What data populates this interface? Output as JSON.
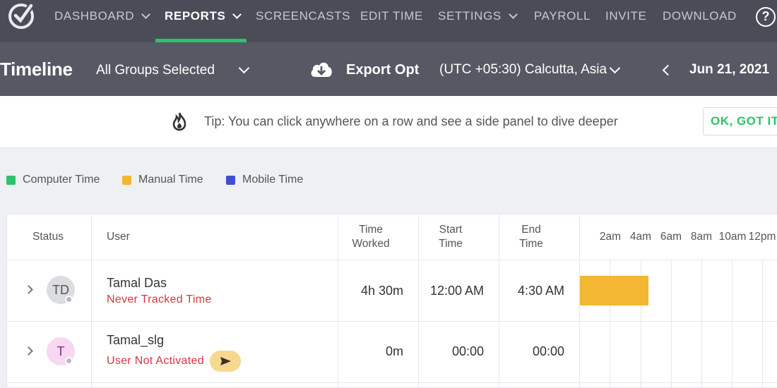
{
  "nav": {
    "items": [
      {
        "label": "DASHBOARD",
        "has_dropdown": true,
        "active": false
      },
      {
        "label": "REPORTS",
        "has_dropdown": true,
        "active": true
      },
      {
        "label": "SCREENCASTS",
        "has_dropdown": false,
        "active": false
      },
      {
        "label": "EDIT TIME",
        "has_dropdown": false,
        "active": false
      },
      {
        "label": "SETTINGS",
        "has_dropdown": true,
        "active": false
      },
      {
        "label": "PAYROLL",
        "has_dropdown": false,
        "active": false
      },
      {
        "label": "INVITE",
        "has_dropdown": false,
        "active": false
      },
      {
        "label": "DOWNLOAD",
        "has_dropdown": false,
        "active": false
      }
    ],
    "help_label": "?"
  },
  "subheader": {
    "title": "Timeline",
    "groups": "All Groups Selected",
    "export": "Export Opt",
    "timezone": "(UTC +05:30) Calcutta, Asia",
    "date": "Jun 21, 2021"
  },
  "tip": {
    "text": "Tip: You can click anywhere on a row and see a side panel to dive deeper",
    "button": "OK, GOT IT"
  },
  "legend": [
    {
      "label": "Computer Time",
      "color": "#2ec26a"
    },
    {
      "label": "Manual Time",
      "color": "#f4b733"
    },
    {
      "label": "Mobile Time",
      "color": "#3f4fd1"
    }
  ],
  "table": {
    "headers": {
      "status": "Status",
      "user": "User",
      "time_worked_1": "Time",
      "time_worked_2": "Worked",
      "start_1": "Start",
      "start_2": "Time",
      "end_1": "End",
      "end_2": "Time"
    },
    "timeline_ticks": [
      "2am",
      "4am",
      "6am",
      "8am",
      "10am",
      "12pm"
    ],
    "rows": [
      {
        "avatar": "TD",
        "avatar_bg": "#dcdde1",
        "avatar_color": "#555555",
        "name": "Tamal Das",
        "status": "Never Tracked Time",
        "time_worked": "4h 30m",
        "start": "12:00 AM",
        "end": "4:30 AM",
        "segments": [
          {
            "type": "manual",
            "start_hour": 0,
            "end_hour": 4.5,
            "color": "#f4b733"
          }
        ]
      },
      {
        "avatar": "T",
        "avatar_bg": "#f8d7f3",
        "avatar_color": "#8b2d7f",
        "name": "Tamal_slg",
        "status": "User Not Activated",
        "time_worked": "0m",
        "start": "00:00",
        "end": "00:00",
        "segments": []
      }
    ]
  }
}
